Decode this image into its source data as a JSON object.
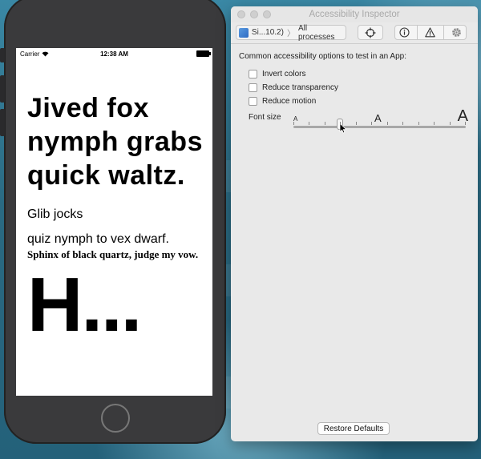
{
  "phone": {
    "statusbar": {
      "carrier": "Carrier",
      "time": "12:38 AM"
    },
    "text": {
      "big_bold": "Jived fox nymph grabs quick waltz.",
      "inline_small": "Glib jocks",
      "line2": "quiz nymph to vex dwarf.",
      "serif": "Sphinx of black quartz, judge my vow.",
      "huge": "H..."
    }
  },
  "inspector": {
    "title": "Accessibility Inspector",
    "target": {
      "app": "Si...10.2)",
      "process": "All processes"
    },
    "toolbar_icons": [
      "crosshair-icon",
      "info-icon",
      "warning-icon",
      "gear-icon"
    ],
    "description": "Common accessibility options to test in an App:",
    "options": [
      {
        "label": "Invert colors",
        "checked": false
      },
      {
        "label": "Reduce transparency",
        "checked": false
      },
      {
        "label": "Reduce motion",
        "checked": false
      }
    ],
    "font_size": {
      "label": "Font size",
      "small_marker": "A",
      "mid_marker": "A",
      "large_marker": "A",
      "steps": 12,
      "value_step": 3
    },
    "restore_label": "Restore Defaults"
  },
  "colors": {
    "desktop": "#2d6f86",
    "phone_body": "#3a3a3c",
    "window_bg": "#e9e9e9"
  }
}
